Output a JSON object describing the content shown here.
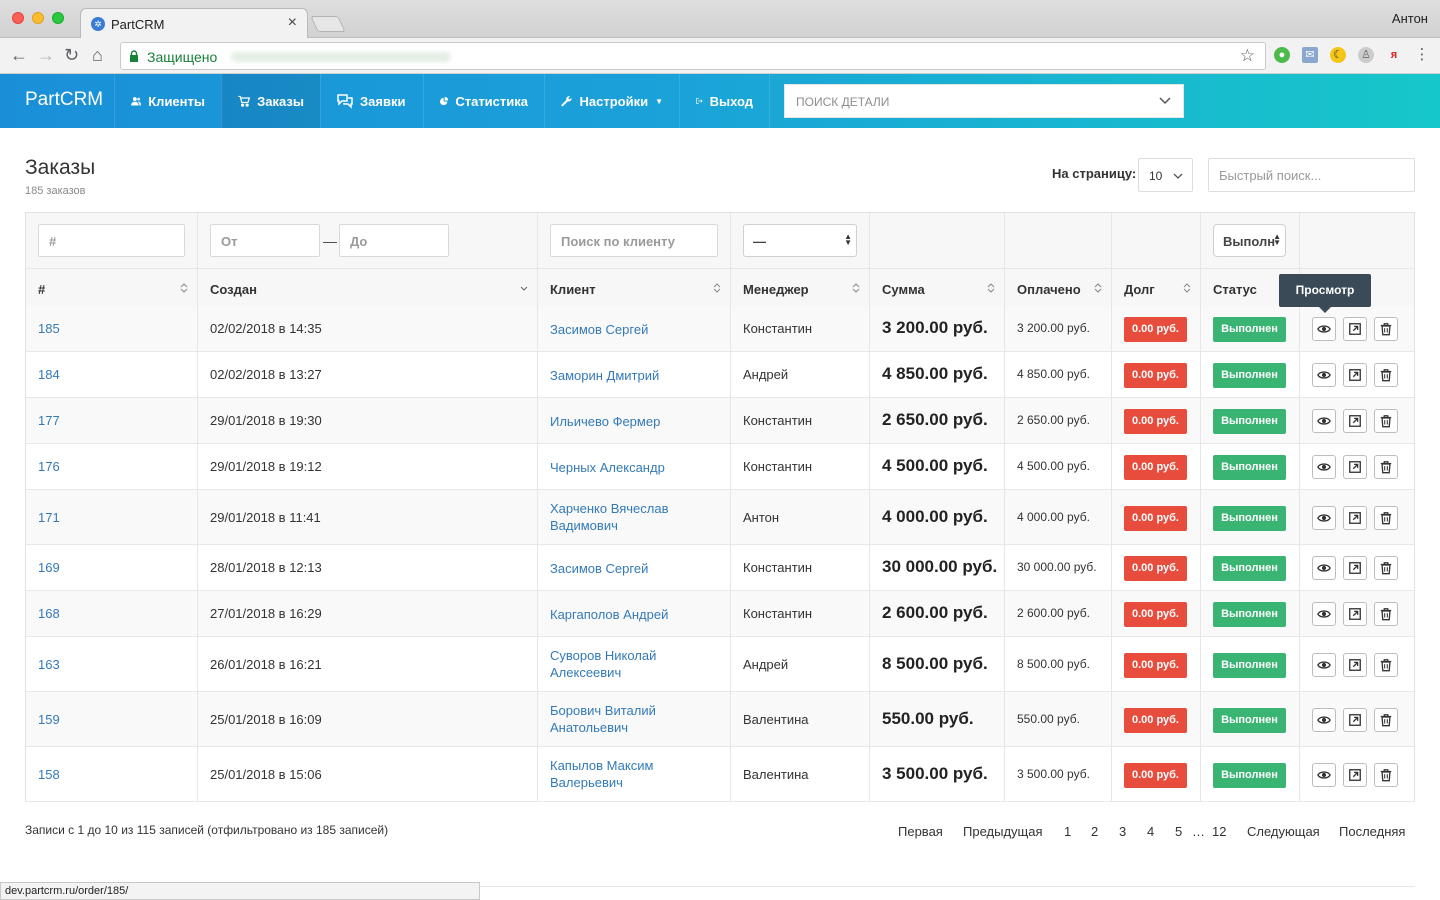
{
  "browser": {
    "tab_title": "PartCRM",
    "user": "Антон",
    "secure_label": "Защищено",
    "status_url": "dev.partcrm.ru/order/185/"
  },
  "navbar": {
    "brand": "PartCRM",
    "items": [
      {
        "label": "Клиенты",
        "icon": "users-icon"
      },
      {
        "label": "Заказы",
        "icon": "cart-icon"
      },
      {
        "label": "Заявки",
        "icon": "comments-icon"
      },
      {
        "label": "Статистика",
        "icon": "pie-chart-icon"
      },
      {
        "label": "Настройки",
        "icon": "wrench-icon"
      },
      {
        "label": "Выход",
        "icon": "logout-icon"
      }
    ],
    "detail_search_placeholder": "ПОИСК ДЕТАЛИ"
  },
  "page": {
    "title": "Заказы",
    "subtitle": "185 заказов",
    "per_page_label": "На страницу:",
    "per_page_value": "10",
    "quick_search_placeholder": "Быстрый поиск..."
  },
  "filters": {
    "id_placeholder": "#",
    "from_placeholder": "От",
    "to_placeholder": "До",
    "client_placeholder": "Поиск по клиенту",
    "manager_value": "—",
    "status_value": "Выполн"
  },
  "columns": [
    "#",
    "Создан",
    "Клиент",
    "Менеджер",
    "Сумма",
    "Оплачено",
    "Долг",
    "Статус"
  ],
  "tooltip": "Просмотр",
  "rows": [
    {
      "id": "185",
      "created": "02/02/2018 в 14:35",
      "client": [
        "Засимов Сергей"
      ],
      "manager": "Константин",
      "sum": "3 200.00 руб.",
      "paid": "3 200.00 руб.",
      "debt": "0.00 руб.",
      "status": "Выполнен"
    },
    {
      "id": "184",
      "created": "02/02/2018 в 13:27",
      "client": [
        "Заморин Дмитрий"
      ],
      "manager": "Андрей",
      "sum": "4 850.00 руб.",
      "paid": "4 850.00 руб.",
      "debt": "0.00 руб.",
      "status": "Выполнен"
    },
    {
      "id": "177",
      "created": "29/01/2018 в 19:30",
      "client": [
        "Ильичево Фермер"
      ],
      "manager": "Константин",
      "sum": "2 650.00 руб.",
      "paid": "2 650.00 руб.",
      "debt": "0.00 руб.",
      "status": "Выполнен"
    },
    {
      "id": "176",
      "created": "29/01/2018 в 19:12",
      "client": [
        "Черных Александр"
      ],
      "manager": "Константин",
      "sum": "4 500.00 руб.",
      "paid": "4 500.00 руб.",
      "debt": "0.00 руб.",
      "status": "Выполнен"
    },
    {
      "id": "171",
      "created": "29/01/2018 в 11:41",
      "client": [
        "Харченко Вячеслав",
        "Вадимович"
      ],
      "manager": "Антон",
      "sum": "4 000.00 руб.",
      "paid": "4 000.00 руб.",
      "debt": "0.00 руб.",
      "status": "Выполнен"
    },
    {
      "id": "169",
      "created": "28/01/2018 в 12:13",
      "client": [
        "Засимов Сергей"
      ],
      "manager": "Константин",
      "sum": "30 000.00 руб.",
      "paid": "30 000.00 руб.",
      "debt": "0.00 руб.",
      "status": "Выполнен"
    },
    {
      "id": "168",
      "created": "27/01/2018 в 16:29",
      "client": [
        "Каргаполов Андрей"
      ],
      "manager": "Константин",
      "sum": "2 600.00 руб.",
      "paid": "2 600.00 руб.",
      "debt": "0.00 руб.",
      "status": "Выполнен"
    },
    {
      "id": "163",
      "created": "26/01/2018 в 16:21",
      "client": [
        "Суворов Николай",
        "Алексеевич"
      ],
      "manager": "Андрей",
      "sum": "8 500.00 руб.",
      "paid": "8 500.00 руб.",
      "debt": "0.00 руб.",
      "status": "Выполнен"
    },
    {
      "id": "159",
      "created": "25/01/2018 в 16:09",
      "client": [
        "Борович Виталий",
        "Анатольевич"
      ],
      "manager": "Валентина",
      "sum": "550.00 руб.",
      "paid": "550.00 руб.",
      "debt": "0.00 руб.",
      "status": "Выполнен"
    },
    {
      "id": "158",
      "created": "25/01/2018 в 15:06",
      "client": [
        "Капылов Максим",
        "Валерьевич"
      ],
      "manager": "Валентина",
      "sum": "3 500.00 руб.",
      "paid": "3 500.00 руб.",
      "debt": "0.00 руб.",
      "status": "Выполнен"
    }
  ],
  "footer": {
    "info": "Записи с 1 до 10 из 115 записей (отфильтровано из 185 записей)",
    "pager": [
      "Первая",
      "Предыдущая",
      "1",
      "2",
      "3",
      "4",
      "5",
      "…",
      "12",
      "Следующая",
      "Последняя"
    ]
  },
  "colors": {
    "nav_start": "#1a8fd8",
    "nav_end": "#16c7c9",
    "link": "#337ab7",
    "debt": "#e74c3c",
    "status_done": "#3ab473",
    "tooltip": "#3a4a56"
  }
}
